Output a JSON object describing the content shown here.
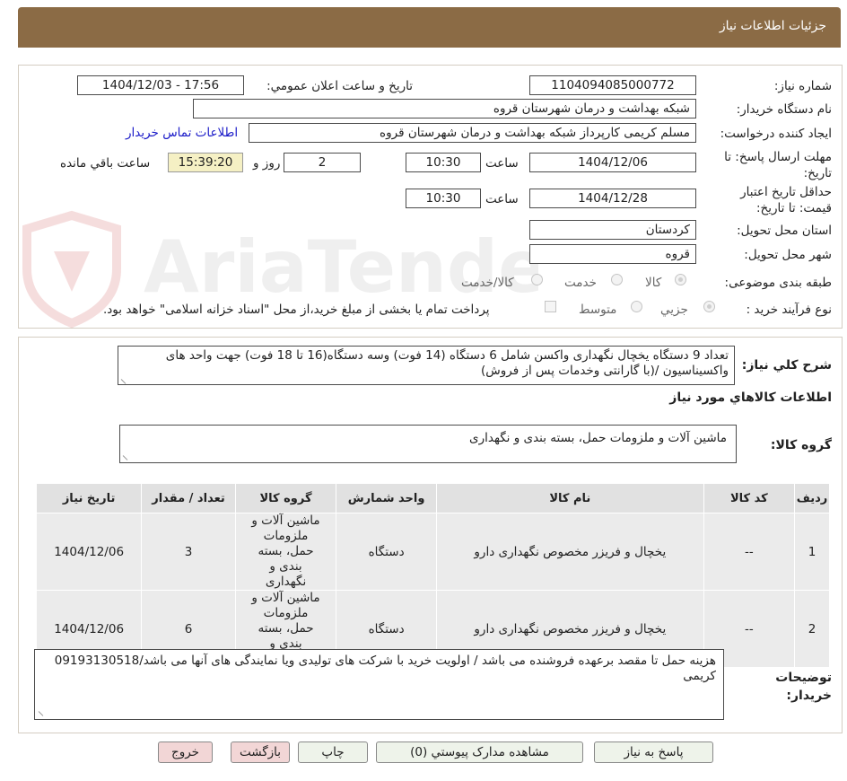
{
  "header": {
    "title": "جزئيات اطلاعات نياز"
  },
  "form": {
    "need_number_label": "شماره نياز:",
    "need_number": "1104094085000772",
    "announce_label": "تاريخ و ساعت اعلان عمومي:",
    "announce_value": "1404/12/03 - 17:56",
    "buyer_org_label": "نام دستگاه خريدار:",
    "buyer_org": "شبکه بهداشت و درمان شهرستان قروه",
    "requester_label": "ايجاد کننده درخواست:",
    "requester": "مسلم کريمی کارپرداز شبکه بهداشت و درمان شهرستان قروه",
    "contact_link": "اطلاعات تماس خريدار",
    "reply_deadline_label": "مهلت ارسال پاسخ: تا تاريخ:",
    "reply_date": "1404/12/06",
    "time_label": "ساعت",
    "reply_time": "10:30",
    "days_value": "2",
    "days_label": "روز و",
    "remaining_time": "15:39:20",
    "remaining_label": "ساعت باقي مانده",
    "validity_label": "حداقل تاريخ اعتبار قيمت: تا تاريخ:",
    "validity_date": "1404/12/28",
    "validity_time": "10:30",
    "province_label": "استان محل تحويل:",
    "province": "کردستان",
    "city_label": "شهر محل تحويل:",
    "city": "قروه",
    "category_label": "طبقه بندی موضوعی:",
    "category_options": [
      "کالا",
      "خدمت",
      "کالا/خدمت"
    ],
    "process_label": "نوع فرآيند خريد :",
    "process_options": [
      "جزيي",
      "متوسط"
    ],
    "treasury_note": "پرداخت تمام يا بخشی از مبلغ خريد،از محل \"اسناد خزانه اسلامی\" خواهد بود."
  },
  "description": {
    "label": "شرح کلي نياز:",
    "text": "تعداد 9 دستگاه يخچال نگهداری واکسن شامل 6 دستگاه (14 فوت) وسه دستگاه(16 تا 18 فوت) جهت واحد های واکسيناسيون /(با گارانتی وخدمات پس از فروش)",
    "items_title": "اطلاعات کالاهاي مورد نياز",
    "group_label": "گروه کالا:",
    "group_value": "ماشين آلات و ملزومات حمل، بسته بندی و نگهداری"
  },
  "table": {
    "headers": [
      "رديف",
      "کد کالا",
      "نام کالا",
      "واحد شمارش",
      "گروه کالا",
      "تعداد / مقدار",
      "تاريخ نياز"
    ],
    "rows": [
      {
        "row": "1",
        "code": "--",
        "name": "يخچال و فريزر مخصوص نگهداری دارو",
        "unit": "دستگاه",
        "group": "ماشين آلات و ملزومات حمل، بسته بندی و نگهداری",
        "qty": "3",
        "date": "1404/12/06"
      },
      {
        "row": "2",
        "code": "--",
        "name": "يخچال و فريزر مخصوص نگهداری دارو",
        "unit": "دستگاه",
        "group": "ماشين آلات و ملزومات حمل، بسته بندی و نگهداری",
        "qty": "6",
        "date": "1404/12/06"
      }
    ]
  },
  "buyer_notes": {
    "label": "توضيحات خريدار:",
    "text": "هزينه حمل تا مقصد برعهده فروشنده می باشد / اولويت خريد با شرکت های توليدی ويا نمايندگی های آنها می باشد/09193130518 کريمی"
  },
  "buttons": {
    "reply": "پاسخ به نياز",
    "attachments": "مشاهده مدارک پيوستي (0)",
    "print": "چاپ",
    "back": "بازگشت",
    "exit": "خروج"
  },
  "watermark": {
    "text": "AriaTender.neT"
  },
  "icons": {
    "watermark_logo": "shield-logo-icon",
    "resize": "resize-grip-icon"
  }
}
